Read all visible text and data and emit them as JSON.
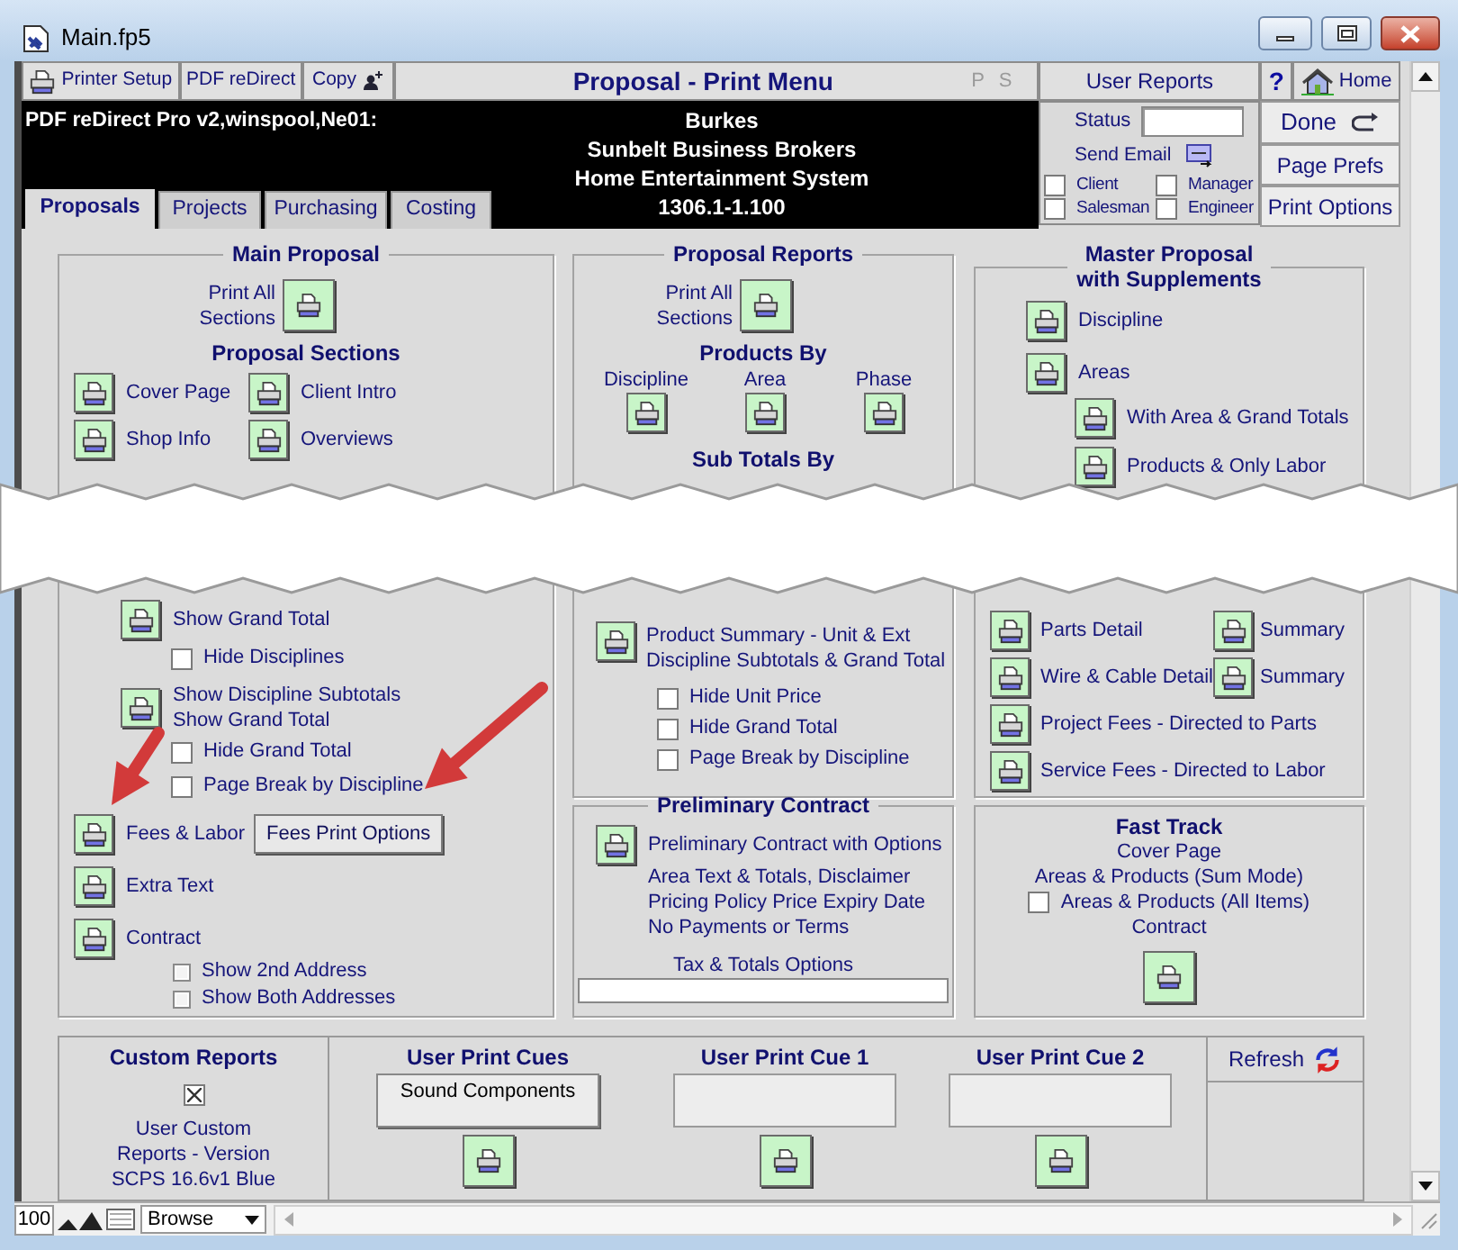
{
  "window": {
    "title": "Main.fp5"
  },
  "toolbar": {
    "buttons": [
      {
        "label": "Printer Setup",
        "kind": "printer"
      },
      {
        "label": "PDF reDirect",
        "kind": "text"
      },
      {
        "label": "Copy",
        "kind": "copy"
      }
    ],
    "title": "Proposal - Print Menu",
    "modes": [
      "P",
      "S"
    ],
    "user_reports": "User Reports",
    "help": "?",
    "home": "Home"
  },
  "header": {
    "printer": "PDF reDirect Pro v2,winspool,Ne01:",
    "lines": [
      "Burkes",
      "Sunbelt Business Brokers",
      "Home Entertainment System",
      "1306.1-1.100"
    ]
  },
  "tabs": [
    {
      "label": "Proposals",
      "selected": true
    },
    {
      "label": "Projects",
      "selected": false
    },
    {
      "label": "Purchasing",
      "selected": false
    },
    {
      "label": "Costing",
      "selected": false
    }
  ],
  "email_panel": {
    "status_label": "Status",
    "send_email": "Send Email",
    "recipients": [
      {
        "label": "Client",
        "checked": false
      },
      {
        "label": "Manager",
        "checked": false
      },
      {
        "label": "Salesman",
        "checked": false
      },
      {
        "label": "Engineer",
        "checked": false
      }
    ]
  },
  "side_buttons": [
    {
      "label": "Done",
      "kind": "done"
    },
    {
      "label": "Page Prefs",
      "kind": "text"
    },
    {
      "label": "Print Options",
      "kind": "text"
    }
  ],
  "main_proposal": {
    "title": "Main Proposal",
    "print_all": "Print All\nSections",
    "sections_title": "Proposal Sections",
    "sections": [
      "Cover Page",
      "Client Intro",
      "Shop Info",
      "Overviews"
    ],
    "items": [
      {
        "kind": "group",
        "children": [
          {
            "kind": "print",
            "label": "Show Grand Total",
            "children": [
              {
                "kind": "checkbox",
                "label": "Hide Disciplines",
                "checked": false
              }
            ]
          },
          {
            "kind": "print",
            "label": "Show Discipline Subtotals\nShow Grand Total",
            "children": [
              {
                "kind": "checkbox",
                "label": "Hide Grand Total",
                "checked": false
              },
              {
                "kind": "checkbox",
                "label": "Page Break by Discipline",
                "checked": false
              }
            ]
          }
        ]
      },
      {
        "kind": "print",
        "label": "Fees & Labor",
        "option": "Fees Print Options"
      },
      {
        "kind": "print",
        "label": "Extra Text"
      },
      {
        "kind": "print",
        "label": "Contract",
        "children": [
          {
            "kind": "small_checkbox",
            "label": "Show 2nd Address",
            "checked": false
          },
          {
            "kind": "small_checkbox",
            "label": "Show Both Addresses",
            "checked": false
          }
        ]
      }
    ]
  },
  "proposal_reports": {
    "title": "Proposal Reports",
    "print_all": "Print All\nSections",
    "products_title": "Products By",
    "products": [
      "Discipline",
      "Area",
      "Phase"
    ],
    "subtotals_title": "Sub Totals By",
    "summary": "Product Summary - Unit & Ext\nDiscipline Subtotals & Grand Total",
    "options": [
      {
        "label": "Hide Unit Price",
        "checked": false
      },
      {
        "label": "Hide Grand Total",
        "checked": false
      },
      {
        "label": "Page Break by Discipline",
        "checked": false
      }
    ]
  },
  "preliminary_contract": {
    "title": "Preliminary Contract",
    "print_label": "Preliminary Contract with Options",
    "details": [
      "Area Text & Totals, Disclaimer",
      "Pricing Policy Price Expiry Date",
      "No Payments or Terms"
    ],
    "tax_label": "Tax & Totals Options"
  },
  "master_proposal": {
    "title": "Master Proposal\nwith Supplements",
    "items": [
      {
        "label": "Discipline"
      },
      {
        "label": "Areas",
        "children": [
          {
            "label": "With Area & Grand Totals"
          },
          {
            "label": "Products & Only Labor"
          }
        ]
      }
    ],
    "details": [
      {
        "label": "Parts Detail",
        "summary": "Summary"
      },
      {
        "label": "Wire & Cable Detail",
        "summary": "Summary"
      },
      {
        "label": "Project Fees - Directed to Parts"
      },
      {
        "label": "Service Fees - Directed to Labor"
      }
    ]
  },
  "fast_track": {
    "title": "Fast Track",
    "lines": [
      "Cover Page",
      "Areas & Products (Sum Mode)"
    ],
    "option": {
      "label": "Areas & Products (All Items)",
      "checked": false
    },
    "contract": "Contract"
  },
  "custom_reports": {
    "title": "Custom Reports",
    "checked": true,
    "description": "User Custom\nReports - Version\nSCPS 16.6v1 Blue"
  },
  "print_cues": [
    {
      "title": "User Print Cues",
      "value": "Sound Components"
    },
    {
      "title": "User Print Cue 1"
    },
    {
      "title": "User Print Cue 2"
    }
  ],
  "refresh": "Refresh",
  "status_bar": {
    "zoom": "100",
    "mode": "Browse"
  }
}
